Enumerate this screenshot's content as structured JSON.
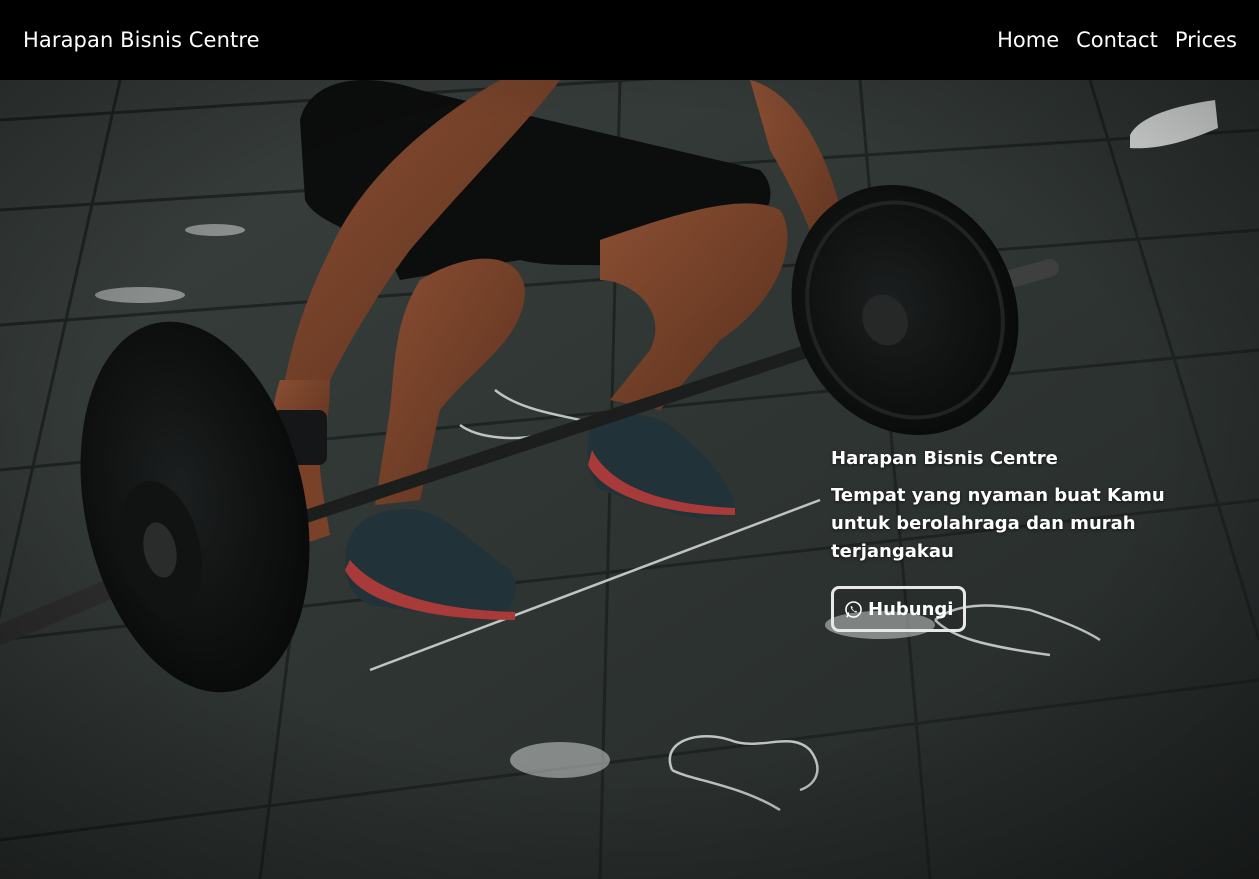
{
  "navbar": {
    "brand": "Harapan Bisnis Centre",
    "links": [
      {
        "label": "Home"
      },
      {
        "label": "Contact"
      },
      {
        "label": "Prices"
      }
    ]
  },
  "hero": {
    "title": "Harapan Bisnis Centre",
    "tagline": "Tempat yang nyaman buat Kamu untuk berolahraga dan murah terjangakau",
    "button_label": "Hubungi",
    "button_icon": "whatsapp-icon",
    "background_image": "weightlifter-deadlift-photo"
  },
  "colors": {
    "navbar_bg": "#000000",
    "text": "#ffffff",
    "button_border": "#e8e8e8"
  }
}
